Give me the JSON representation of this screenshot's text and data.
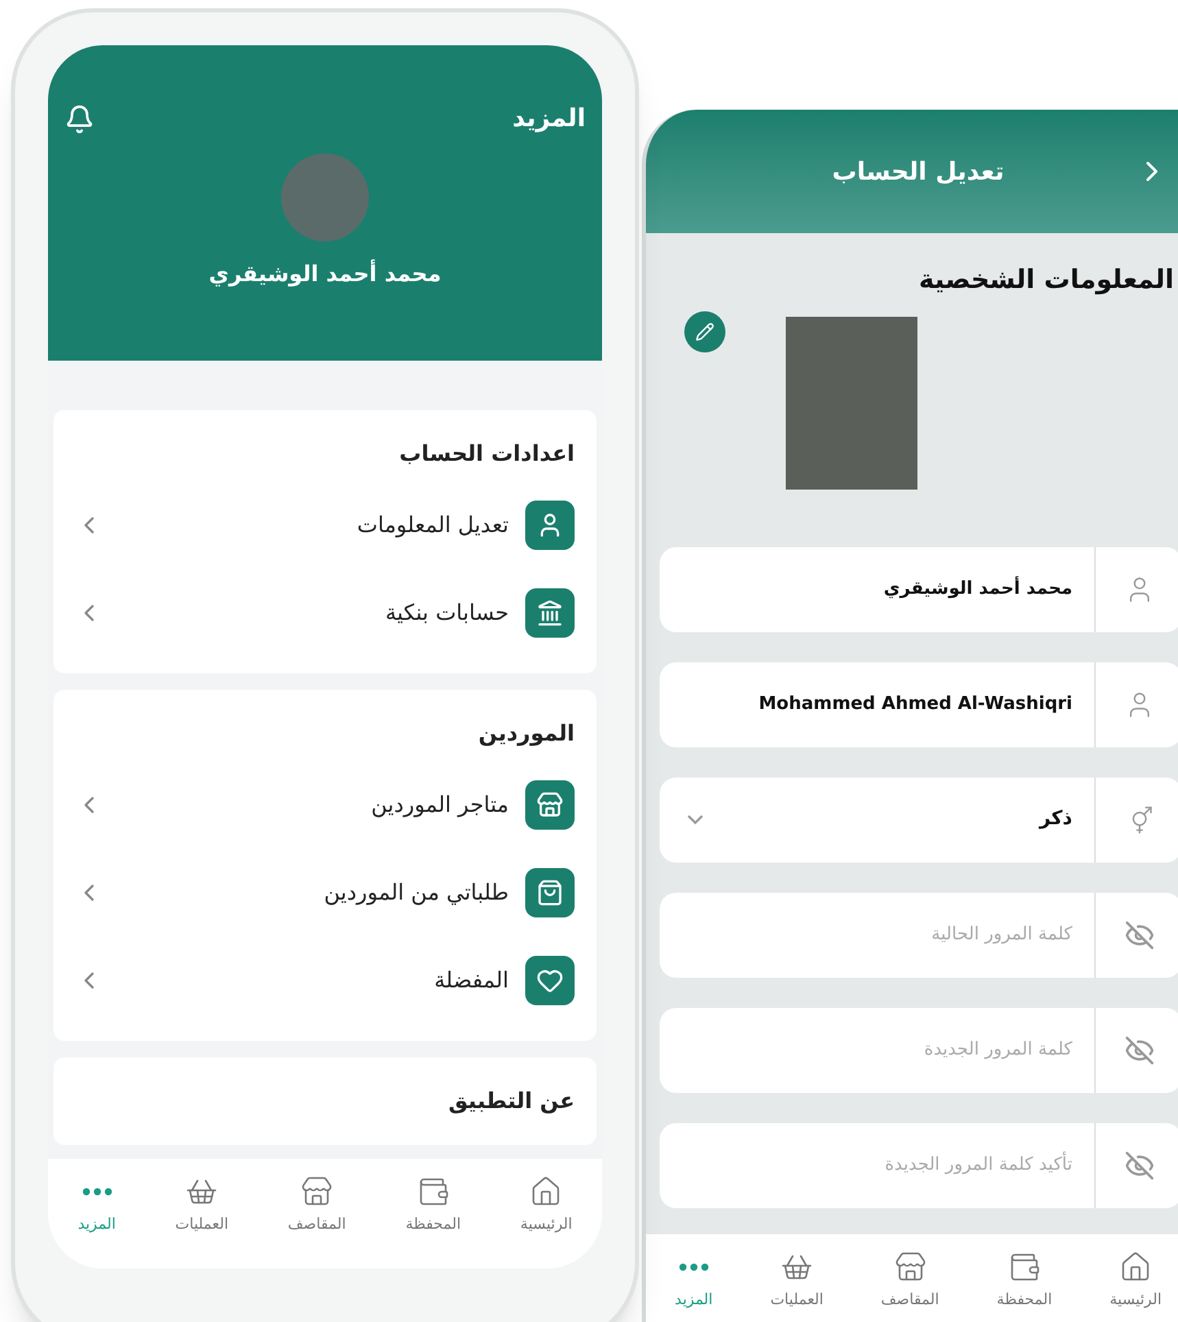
{
  "more_screen": {
    "title": "المزيد",
    "user_name": "محمد أحمد الوشيقري",
    "sections": [
      {
        "title": "اعدادات الحساب",
        "items": [
          {
            "label": "تعديل المعلومات"
          },
          {
            "label": "حسابات بنكية"
          }
        ]
      },
      {
        "title": "الموردين",
        "items": [
          {
            "label": "متاجر الموردين"
          },
          {
            "label": "طلباتي من الموردين"
          },
          {
            "label": "المفضلة"
          }
        ]
      },
      {
        "title": "عن التطبيق"
      }
    ],
    "nav": [
      {
        "label": "الرئيسية",
        "selected": false
      },
      {
        "label": "المحفظة",
        "selected": false
      },
      {
        "label": "المقاصف",
        "selected": false
      },
      {
        "label": "العمليات",
        "selected": false
      },
      {
        "label": "المزيد",
        "selected": true
      }
    ]
  },
  "edit_screen": {
    "title": "تعديل الحساب",
    "section_title": "المعلومات الشخصية",
    "fields": [
      {
        "kind": "name",
        "value": "محمد أحمد الوشيقري"
      },
      {
        "kind": "name",
        "value": "Mohammed Ahmed Al-Washiqri"
      },
      {
        "kind": "select",
        "value": "ذكر"
      },
      {
        "kind": "password",
        "placeholder": "كلمة المرور الحالية"
      },
      {
        "kind": "password",
        "placeholder": "كلمة المرور الجديدة"
      },
      {
        "kind": "password",
        "placeholder": "تأكيد كلمة المرور الجديدة"
      }
    ],
    "nav": [
      {
        "label": "الرئيسية",
        "selected": false
      },
      {
        "label": "المحفظة",
        "selected": false
      },
      {
        "label": "المقاصف",
        "selected": false
      },
      {
        "label": "العمليات",
        "selected": false
      },
      {
        "label": "المزيد",
        "selected": true
      }
    ]
  }
}
